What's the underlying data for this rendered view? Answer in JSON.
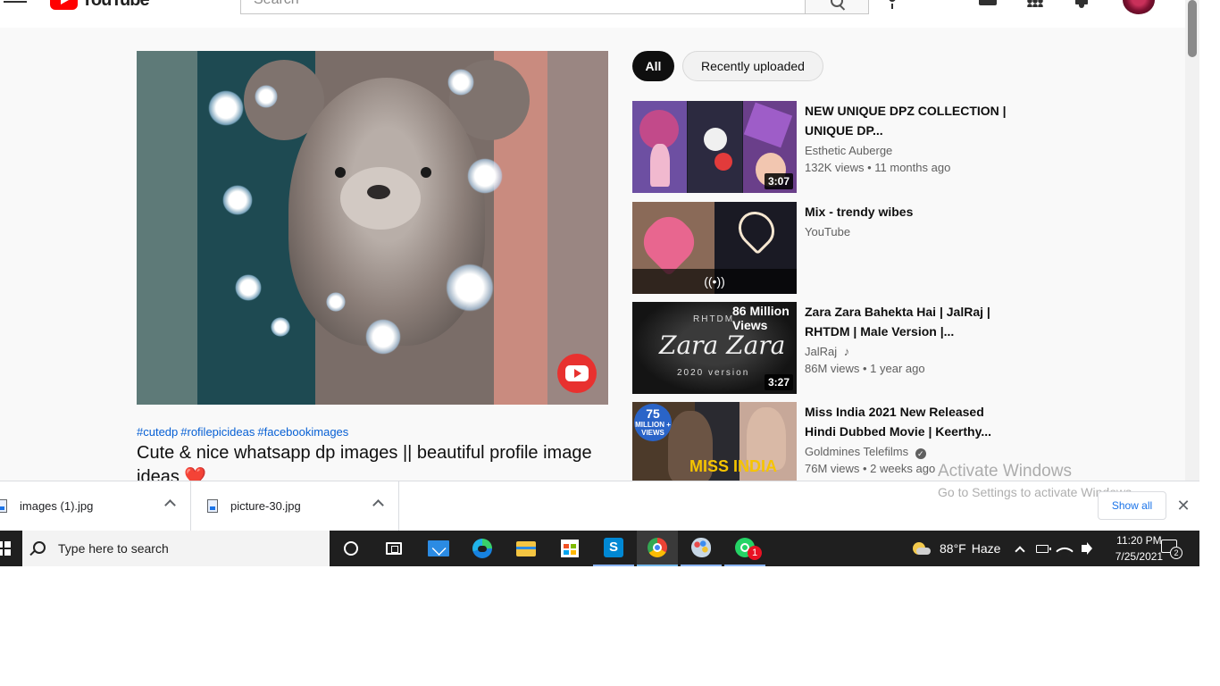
{
  "masthead": {
    "logo_text": "YouTube",
    "search_placeholder": "Search"
  },
  "video": {
    "hashtags": [
      "#cutedp",
      "#rofilepicideas",
      "#facebookimages"
    ],
    "title": "Cute & nice whatsapp dp images || beautiful profile image ideas",
    "title_emoji": "❤️"
  },
  "chips": {
    "all": "All",
    "recently_uploaded": "Recently uploaded"
  },
  "recommendations": [
    {
      "title": "NEW UNIQUE DPZ COLLECTION | UNIQUE DP...",
      "channel": "Esthetic Auberge",
      "meta": "132K views • 11 months ago",
      "duration": "3:07"
    },
    {
      "title": "Mix - trendy wibes",
      "channel": "YouTube",
      "meta": "",
      "live_icon": "((•))"
    },
    {
      "title": "Zara Zara Bahekta Hai | JalRaj | RHTDM | Male Version |...",
      "channel": "JalRaj",
      "channel_icon": "♪",
      "meta": "86M views • 1 year ago",
      "duration": "3:27",
      "thumb_text": {
        "top": "86 Million Views",
        "small": "RHTDM",
        "big": "Zara Zara",
        "version": "2020 version"
      }
    },
    {
      "title": "Miss India 2021 New Released Hindi Dubbed Movie | Keerthy...",
      "channel": "Goldmines Telefilms",
      "verified": "✓",
      "meta": "76M views • 2 weeks ago",
      "thumb_text": {
        "badge_num": "75",
        "badge_text": "MILLION + VIEWS",
        "miss": "MISS INDIA"
      }
    }
  ],
  "watermark": {
    "line1": "Activate Windows",
    "line2": "Go to Settings to activate Windows."
  },
  "downloads": {
    "items": [
      "images (1).jpg",
      "picture-30.jpg"
    ],
    "show_all": "Show all",
    "close": "✕"
  },
  "taskbar": {
    "search_placeholder": "Type here to search",
    "whatsapp_badge": "1",
    "temperature": "88°F",
    "weather": "Haze",
    "time": "11:20 PM",
    "date": "7/25/2021",
    "notification_count": "2"
  },
  "colors": {
    "youtube_red": "#ff0000",
    "link_blue": "#065fd4",
    "taskbar_bg": "#1f1f1f",
    "chip_active": "#0f0f0f"
  }
}
